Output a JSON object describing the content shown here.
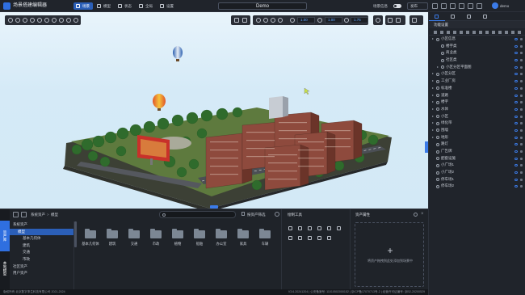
{
  "topbar": {
    "app_title": "场景搭建编辑器",
    "nav": [
      {
        "label": "场景",
        "active": true
      },
      {
        "label": "模型",
        "active": false
      },
      {
        "label": "状态",
        "active": false
      },
      {
        "label": "全局",
        "active": false
      },
      {
        "label": "设置",
        "active": false
      }
    ],
    "document_name": "Demo",
    "mode_label": "场景信息",
    "publish_label": "发布",
    "user": "demo",
    "accent": "#2f6fe0"
  },
  "viewport": {
    "inputs": [
      "1.00",
      "1.00",
      "1.75"
    ]
  },
  "right_panel": {
    "title": "功能设置",
    "layers": [
      {
        "label": "小区信息",
        "level": 1,
        "caret": true
      },
      {
        "label": "楼宇类",
        "level": 2
      },
      {
        "label": "商业类",
        "level": 2
      },
      {
        "label": "社区类",
        "level": 2
      },
      {
        "label": "小区分区平面图",
        "level": 2,
        "caret": true
      },
      {
        "label": "小区分区",
        "level": 1,
        "caret": true
      },
      {
        "label": "工业厂房",
        "level": 1,
        "caret": true
      },
      {
        "label": "标准楼",
        "level": 1,
        "caret": true
      },
      {
        "label": "道路",
        "level": 1,
        "caret": true
      },
      {
        "label": "楼宇",
        "level": 1,
        "caret": true
      },
      {
        "label": "水体",
        "level": 1,
        "caret": true
      },
      {
        "label": "小区",
        "level": 1,
        "caret": true
      },
      {
        "label": "绿化带",
        "level": 1,
        "caret": true
      },
      {
        "label": "围墙",
        "level": 1,
        "caret": true
      },
      {
        "label": "地形",
        "level": 1,
        "caret": true
      },
      {
        "label": "路灯",
        "level": 1
      },
      {
        "label": "广告牌",
        "level": 1
      },
      {
        "label": "配套设施",
        "level": 1
      },
      {
        "label": "小广场1",
        "level": 1
      },
      {
        "label": "小广场2",
        "level": 1
      },
      {
        "label": "停车场1",
        "level": 1
      },
      {
        "label": "停车场2",
        "level": 1
      }
    ]
  },
  "bottom": {
    "side_tabs": [
      "资产库",
      "本地模型"
    ],
    "breadcrumb": [
      "系统资产",
      "模型"
    ],
    "search_placeholder": "",
    "filter_label": "按资产筛选",
    "asset_tree": [
      {
        "label": "系统资产",
        "level": 0,
        "selected": false
      },
      {
        "label": "模型",
        "level": 1,
        "selected": true
      },
      {
        "label": "基本几何体",
        "level": 2,
        "selected": false
      },
      {
        "label": "建筑",
        "level": 2,
        "selected": false
      },
      {
        "label": "交通",
        "level": 2,
        "selected": false
      },
      {
        "label": "市政",
        "level": 2,
        "selected": false
      },
      {
        "label": "社区资产",
        "level": 0,
        "selected": false
      },
      {
        "label": "用户资产",
        "level": 0,
        "selected": false
      }
    ],
    "folders": [
      "基本几何体",
      "建筑",
      "交通",
      "市政",
      "植物",
      "船舶",
      "办公室",
      "家具",
      "车辆"
    ],
    "draw_tools_title": "绘制工具",
    "properties_title": "资产属性",
    "empty_hint": "将资产拖拽到此处添加到场景中"
  },
  "statusbar": {
    "left": "版权所有 北京数字孪生科技有限公司 2021-2024",
    "right": "V3.6.20241204 | 公安备案号: 11010502000152 | 京ICP备17070713号-2 | 经营许可证编号: 京B2-20200529"
  }
}
